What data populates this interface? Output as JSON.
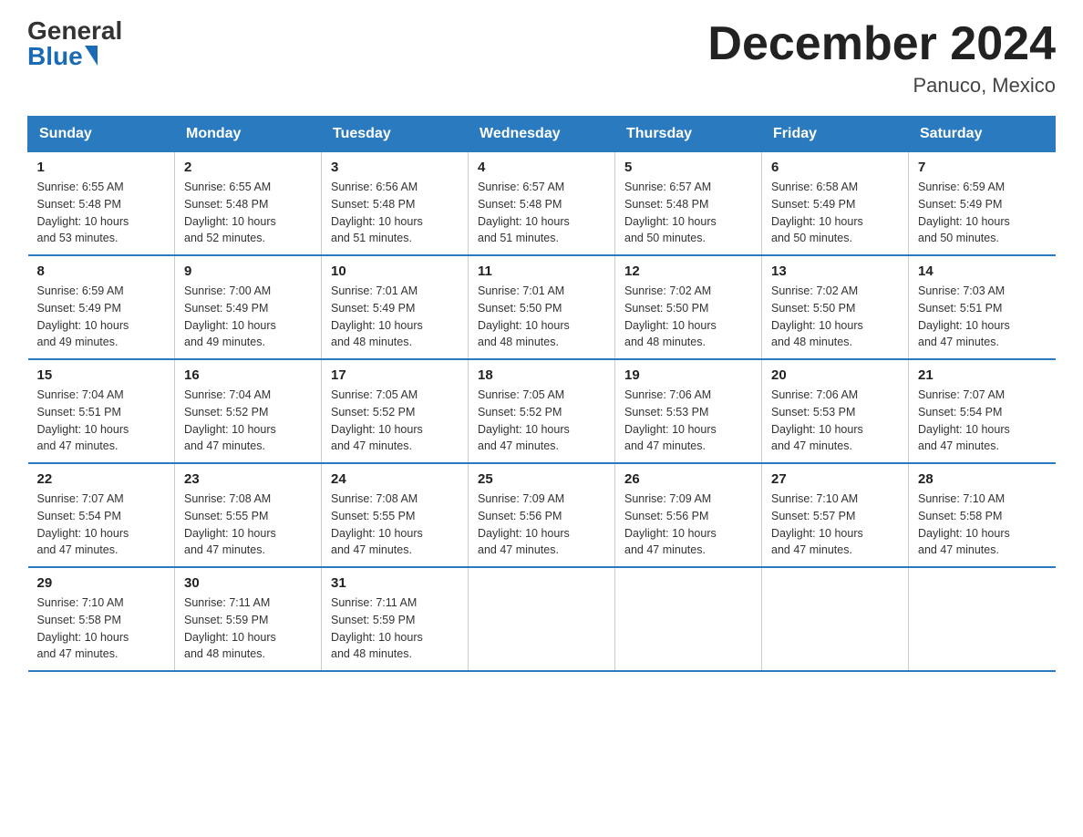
{
  "header": {
    "logo_general": "General",
    "logo_blue": "Blue",
    "month_title": "December 2024",
    "location": "Panuco, Mexico"
  },
  "days_of_week": [
    "Sunday",
    "Monday",
    "Tuesday",
    "Wednesday",
    "Thursday",
    "Friday",
    "Saturday"
  ],
  "weeks": [
    [
      {
        "day": "1",
        "sunrise": "6:55 AM",
        "sunset": "5:48 PM",
        "daylight": "10 hours and 53 minutes."
      },
      {
        "day": "2",
        "sunrise": "6:55 AM",
        "sunset": "5:48 PM",
        "daylight": "10 hours and 52 minutes."
      },
      {
        "day": "3",
        "sunrise": "6:56 AM",
        "sunset": "5:48 PM",
        "daylight": "10 hours and 51 minutes."
      },
      {
        "day": "4",
        "sunrise": "6:57 AM",
        "sunset": "5:48 PM",
        "daylight": "10 hours and 51 minutes."
      },
      {
        "day": "5",
        "sunrise": "6:57 AM",
        "sunset": "5:48 PM",
        "daylight": "10 hours and 50 minutes."
      },
      {
        "day": "6",
        "sunrise": "6:58 AM",
        "sunset": "5:49 PM",
        "daylight": "10 hours and 50 minutes."
      },
      {
        "day": "7",
        "sunrise": "6:59 AM",
        "sunset": "5:49 PM",
        "daylight": "10 hours and 50 minutes."
      }
    ],
    [
      {
        "day": "8",
        "sunrise": "6:59 AM",
        "sunset": "5:49 PM",
        "daylight": "10 hours and 49 minutes."
      },
      {
        "day": "9",
        "sunrise": "7:00 AM",
        "sunset": "5:49 PM",
        "daylight": "10 hours and 49 minutes."
      },
      {
        "day": "10",
        "sunrise": "7:01 AM",
        "sunset": "5:49 PM",
        "daylight": "10 hours and 48 minutes."
      },
      {
        "day": "11",
        "sunrise": "7:01 AM",
        "sunset": "5:50 PM",
        "daylight": "10 hours and 48 minutes."
      },
      {
        "day": "12",
        "sunrise": "7:02 AM",
        "sunset": "5:50 PM",
        "daylight": "10 hours and 48 minutes."
      },
      {
        "day": "13",
        "sunrise": "7:02 AM",
        "sunset": "5:50 PM",
        "daylight": "10 hours and 48 minutes."
      },
      {
        "day": "14",
        "sunrise": "7:03 AM",
        "sunset": "5:51 PM",
        "daylight": "10 hours and 47 minutes."
      }
    ],
    [
      {
        "day": "15",
        "sunrise": "7:04 AM",
        "sunset": "5:51 PM",
        "daylight": "10 hours and 47 minutes."
      },
      {
        "day": "16",
        "sunrise": "7:04 AM",
        "sunset": "5:52 PM",
        "daylight": "10 hours and 47 minutes."
      },
      {
        "day": "17",
        "sunrise": "7:05 AM",
        "sunset": "5:52 PM",
        "daylight": "10 hours and 47 minutes."
      },
      {
        "day": "18",
        "sunrise": "7:05 AM",
        "sunset": "5:52 PM",
        "daylight": "10 hours and 47 minutes."
      },
      {
        "day": "19",
        "sunrise": "7:06 AM",
        "sunset": "5:53 PM",
        "daylight": "10 hours and 47 minutes."
      },
      {
        "day": "20",
        "sunrise": "7:06 AM",
        "sunset": "5:53 PM",
        "daylight": "10 hours and 47 minutes."
      },
      {
        "day": "21",
        "sunrise": "7:07 AM",
        "sunset": "5:54 PM",
        "daylight": "10 hours and 47 minutes."
      }
    ],
    [
      {
        "day": "22",
        "sunrise": "7:07 AM",
        "sunset": "5:54 PM",
        "daylight": "10 hours and 47 minutes."
      },
      {
        "day": "23",
        "sunrise": "7:08 AM",
        "sunset": "5:55 PM",
        "daylight": "10 hours and 47 minutes."
      },
      {
        "day": "24",
        "sunrise": "7:08 AM",
        "sunset": "5:55 PM",
        "daylight": "10 hours and 47 minutes."
      },
      {
        "day": "25",
        "sunrise": "7:09 AM",
        "sunset": "5:56 PM",
        "daylight": "10 hours and 47 minutes."
      },
      {
        "day": "26",
        "sunrise": "7:09 AM",
        "sunset": "5:56 PM",
        "daylight": "10 hours and 47 minutes."
      },
      {
        "day": "27",
        "sunrise": "7:10 AM",
        "sunset": "5:57 PM",
        "daylight": "10 hours and 47 minutes."
      },
      {
        "day": "28",
        "sunrise": "7:10 AM",
        "sunset": "5:58 PM",
        "daylight": "10 hours and 47 minutes."
      }
    ],
    [
      {
        "day": "29",
        "sunrise": "7:10 AM",
        "sunset": "5:58 PM",
        "daylight": "10 hours and 47 minutes."
      },
      {
        "day": "30",
        "sunrise": "7:11 AM",
        "sunset": "5:59 PM",
        "daylight": "10 hours and 48 minutes."
      },
      {
        "day": "31",
        "sunrise": "7:11 AM",
        "sunset": "5:59 PM",
        "daylight": "10 hours and 48 minutes."
      },
      null,
      null,
      null,
      null
    ]
  ],
  "labels": {
    "sunrise": "Sunrise:",
    "sunset": "Sunset:",
    "daylight": "Daylight:"
  }
}
